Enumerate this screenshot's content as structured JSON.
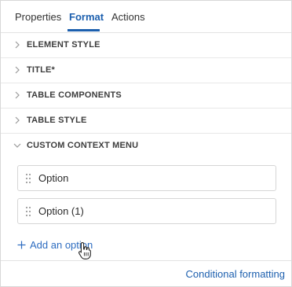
{
  "tabs": [
    {
      "label": "Properties",
      "active": false
    },
    {
      "label": "Format",
      "active": true
    },
    {
      "label": "Actions",
      "active": false
    }
  ],
  "sections": [
    {
      "label": "ELEMENT STYLE",
      "expanded": false
    },
    {
      "label": "TITLE*",
      "expanded": false
    },
    {
      "label": "TABLE COMPONENTS",
      "expanded": false
    },
    {
      "label": "TABLE STYLE",
      "expanded": false
    },
    {
      "label": "CUSTOM CONTEXT MENU",
      "expanded": true
    }
  ],
  "options": [
    {
      "label": "Option"
    },
    {
      "label": "Option (1)"
    }
  ],
  "add_option_label": "Add an option",
  "footer": {
    "link_label": "Conditional formatting"
  },
  "colors": {
    "accent": "#1c5fae",
    "link": "#2d6cc0"
  },
  "icons": [
    "chevron-right-icon",
    "chevron-down-icon",
    "drag-handle-icon",
    "plus-icon",
    "hand-pointer-cursor-icon"
  ]
}
